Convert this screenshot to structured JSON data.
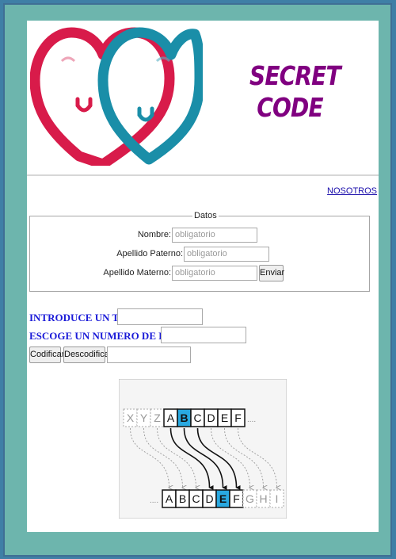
{
  "header": {
    "title_line1": "SECRET",
    "title_line2": "CODE"
  },
  "nav": {
    "nosotros": "NOSOTROS"
  },
  "form_datos": {
    "legend": "Datos",
    "nombre_label": "Nombre:",
    "apellido_paterno_label": "Apellido Paterno:",
    "apellido_materno_label": "Apellido Materno:",
    "placeholder": "obligatorio",
    "enviar": "Enviar"
  },
  "cipher_form": {
    "texto_label": "INTRODUCE UN TEXTO:",
    "posicion_label": "ESCOGE UN NUMERO DE POSICION:",
    "codificar": "Codificar",
    "descodificar": "Descodificar"
  },
  "diagram": {
    "top_letters": [
      "X",
      "Y",
      "Z",
      "A",
      "B",
      "C",
      "D",
      "E",
      "F"
    ],
    "bottom_letters": [
      "A",
      "B",
      "C",
      "D",
      "E",
      "F",
      "G",
      "H",
      "I"
    ],
    "ellipsis": "....",
    "highlight_color": "#29a9e1"
  },
  "colors": {
    "heart_red": "#d81b4a",
    "heart_teal": "#1a8ea8",
    "title": "#800080",
    "form_label": "#1b1bd8"
  }
}
